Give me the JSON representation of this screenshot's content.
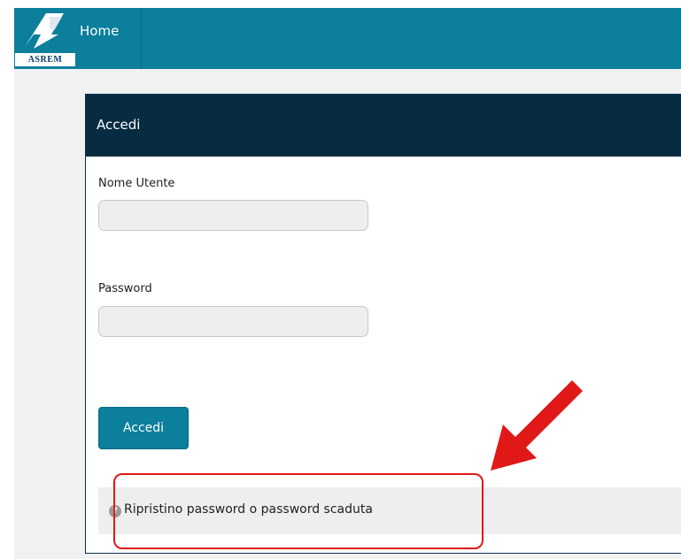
{
  "app": {
    "logo_text": "ASREM",
    "nav_home": "Home"
  },
  "panel": {
    "title": "Accedi"
  },
  "form": {
    "username_label": "Nome Utente",
    "username_value": "",
    "password_label": "Password",
    "password_value": "",
    "submit_label": "Accedi"
  },
  "footer": {
    "reset_link": "Ripristino password o password scaduta",
    "help_icon": "question-circle-icon"
  },
  "annotation": {
    "arrow_color": "#e01818",
    "box_color": "#e01818"
  },
  "colors": {
    "navbar": "#0b7f9b",
    "panel_header": "#072c41",
    "button": "#0b7f9b"
  }
}
